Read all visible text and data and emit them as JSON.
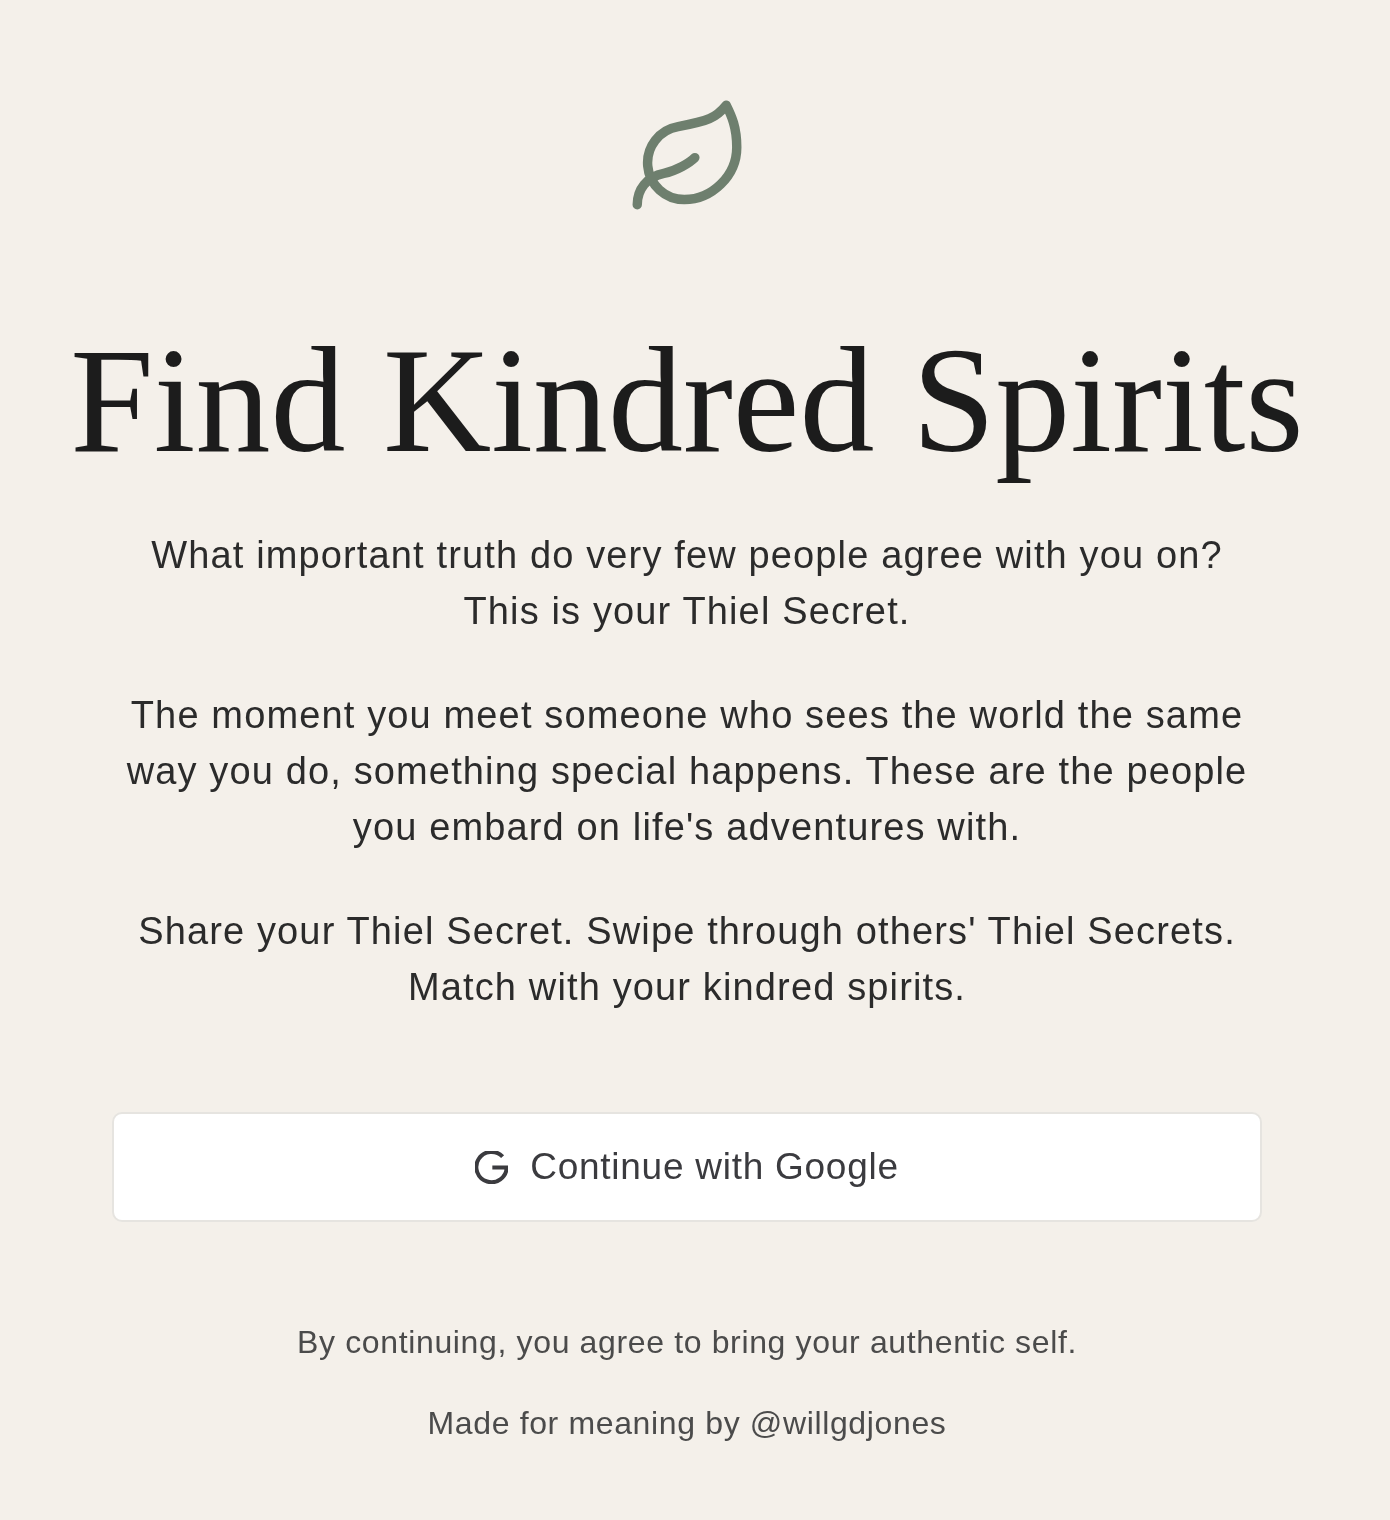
{
  "headline": "Find Kindred Spirits",
  "intro_paragraphs": [
    {
      "lines": [
        "What important truth do very few people agree with you on?",
        "This is your Thiel Secret."
      ]
    },
    {
      "lines": [
        "The moment you meet someone who sees the world the same",
        "way you do, something special happens. These are the people",
        "you embard on life's adventures with."
      ]
    },
    {
      "lines": [
        "Share your Thiel Secret. Swipe through others' Thiel Secrets.",
        "Match with your kindred spirits."
      ]
    }
  ],
  "sign_in_button": {
    "label": "Continue with Google"
  },
  "footer": {
    "agreement": "By continuing, you agree to bring your authentic self.",
    "credit": "Made for meaning by @willgdjones"
  }
}
